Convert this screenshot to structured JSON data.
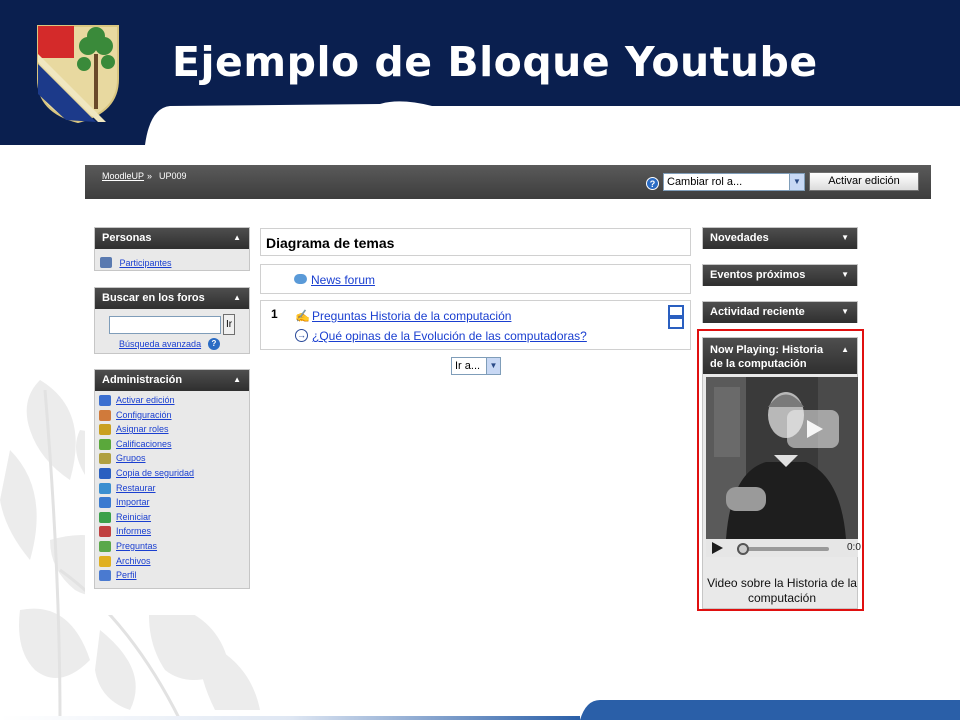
{
  "slide": {
    "title": "Ejemplo de Bloque Youtube",
    "colors": {
      "navy": "#0a1f4f",
      "footer_blue": "#2a5fa8",
      "highlight_red": "#e01010"
    }
  },
  "navbar": {
    "breadcrumb_home": "MoodleUP",
    "breadcrumb_sep": "»",
    "breadcrumb_current": "UP009",
    "help_icon": "?",
    "role_select_value": "Cambiar rol a...",
    "edit_button": "Activar edición"
  },
  "left": {
    "personas": {
      "title": "Personas",
      "toggle": "⇞",
      "items": [
        {
          "label": "Participantes",
          "icon": "users-icon"
        }
      ]
    },
    "buscar": {
      "title": "Buscar en los foros",
      "toggle": "⇞",
      "search_value": "",
      "go_button": "Ir",
      "advanced": "Búsqueda avanzada"
    },
    "admin": {
      "title": "Administración",
      "toggle": "⇞",
      "items": [
        {
          "label": "Activar edición",
          "icon": "edit-icon",
          "color": "#3b6fd0"
        },
        {
          "label": "Configuración",
          "icon": "settings-icon",
          "color": "#d07a3b"
        },
        {
          "label": "Asignar roles",
          "icon": "roles-icon",
          "color": "#caa020"
        },
        {
          "label": "Calificaciones",
          "icon": "grades-icon",
          "color": "#5aa83b"
        },
        {
          "label": "Grupos",
          "icon": "groups-icon",
          "color": "#b0a040"
        },
        {
          "label": "Copia de seguridad",
          "icon": "backup-icon",
          "color": "#2a5fc0"
        },
        {
          "label": "Restaurar",
          "icon": "restore-icon",
          "color": "#3b8fd0"
        },
        {
          "label": "Importar",
          "icon": "import-icon",
          "color": "#3a7ad0"
        },
        {
          "label": "Reiniciar",
          "icon": "reset-icon",
          "color": "#3aa04a"
        },
        {
          "label": "Informes",
          "icon": "reports-icon",
          "color": "#c04040"
        },
        {
          "label": "Preguntas",
          "icon": "questions-icon",
          "color": "#5aa84a"
        },
        {
          "label": "Archivos",
          "icon": "files-icon",
          "color": "#e0b020"
        },
        {
          "label": "Perfil",
          "icon": "profile-icon",
          "color": "#4a7ad0"
        }
      ]
    }
  },
  "center": {
    "title": "Diagrama de temas",
    "news_forum": "News forum",
    "section_number": "1",
    "links": [
      {
        "label": "Preguntas Historia de la computación",
        "icon": "quiz-icon"
      },
      {
        "label": "¿Qué opinas de la Evolución de las computadoras?",
        "icon": "link-icon"
      }
    ],
    "jump_select": "Ir a..."
  },
  "right": {
    "blocks": [
      {
        "title": "Novedades",
        "toggle": "⇟"
      },
      {
        "title": "Eventos próximos",
        "toggle": "⇟"
      },
      {
        "title": "Actividad reciente",
        "toggle": "⇟"
      }
    ],
    "video": {
      "title_line1": "Now Playing: Historia",
      "title_line2": "de la computación",
      "toggle": "⇞",
      "time": "0:0",
      "desc_line1": "Video sobre la Historia de la",
      "desc_line2": "computación"
    }
  }
}
